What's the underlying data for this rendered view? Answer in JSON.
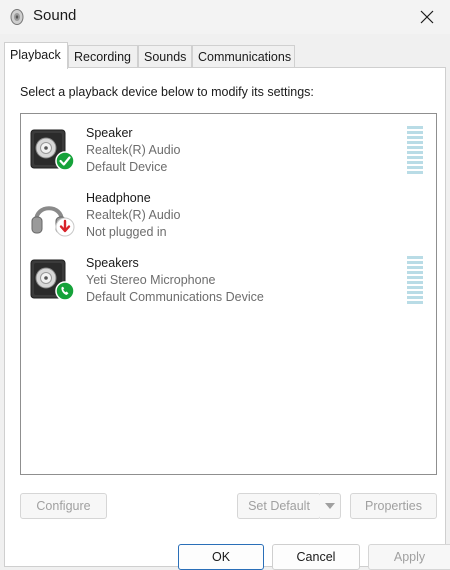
{
  "window": {
    "title": "Sound",
    "icon": "speaker-icon"
  },
  "tabs": [
    {
      "label": "Playback",
      "active": true
    },
    {
      "label": "Recording",
      "active": false
    },
    {
      "label": "Sounds",
      "active": false
    },
    {
      "label": "Communications",
      "active": false
    }
  ],
  "instruction": "Select a playback device below to modify its settings:",
  "devices": [
    {
      "name": "Speaker",
      "driver": "Realtek(R) Audio",
      "status": "Default Device",
      "icon": "speaker-default-icon",
      "badge": "green-check"
    },
    {
      "name": "Headphone",
      "driver": "Realtek(R) Audio",
      "status": "Not plugged in",
      "icon": "headphone-icon",
      "badge": "red-down-arrow"
    },
    {
      "name": "Speakers",
      "driver": "Yeti Stereo Microphone",
      "status": "Default Communications Device",
      "icon": "speaker-communications-icon",
      "badge": "green-phone"
    }
  ],
  "buttons": {
    "configure": "Configure",
    "set_default": "Set Default",
    "properties": "Properties",
    "ok": "OK",
    "cancel": "Cancel",
    "apply": "Apply"
  },
  "colors": {
    "accent": "#2a6fb8",
    "badge_green": "#16a23a",
    "badge_red": "#d8232a",
    "meter": "#b9dce6"
  }
}
